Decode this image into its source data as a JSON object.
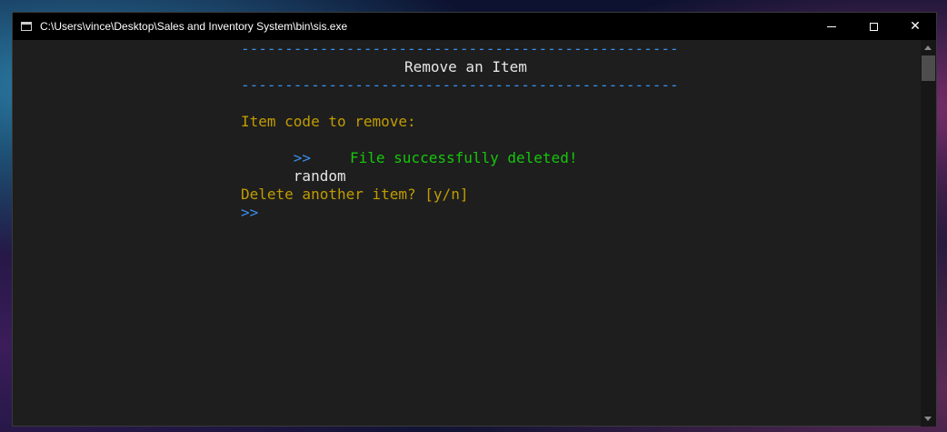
{
  "window": {
    "title": "C:\\Users\\vince\\Desktop\\Sales and Inventory System\\bin\\sis.exe"
  },
  "controls": {
    "minimize": "minimize",
    "maximize": "maximize",
    "close": "✕"
  },
  "console": {
    "separator": "--------------------------------------------------",
    "header": "Remove an Item",
    "prompt_label": "Item code to remove:",
    "prompt_symbol": ">>",
    "input_value": "random",
    "status_message": "File successfully deleted!",
    "confirm_label": "Delete another item? [y/n]",
    "confirm_symbol": ">>"
  },
  "colors": {
    "blue": "#3b8eea",
    "gold": "#c19c00",
    "green": "#16c60c",
    "background": "#1e1e1e"
  }
}
